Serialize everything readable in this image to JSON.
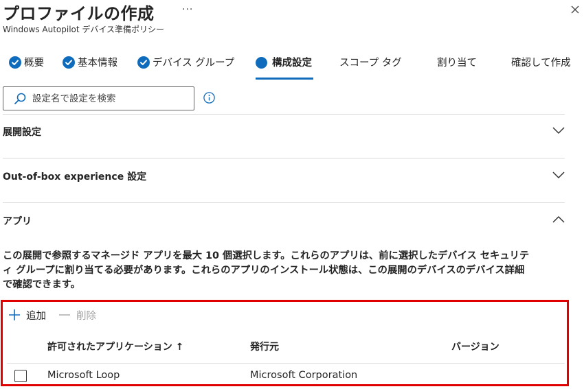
{
  "header": {
    "title": "プロファイルの作成",
    "more_label": "···",
    "subtitle": "Windows Autopilot デバイス準備ポリシー"
  },
  "tabs": [
    {
      "label": "概要",
      "state": "completed"
    },
    {
      "label": "基本情報",
      "state": "completed"
    },
    {
      "label": "デバイス グループ",
      "state": "completed"
    },
    {
      "label": "構成設定",
      "state": "active"
    },
    {
      "label": "スコープ タグ",
      "state": "pending"
    },
    {
      "label": "割り当て",
      "state": "pending"
    },
    {
      "label": "確認して作成",
      "state": "pending"
    }
  ],
  "search": {
    "placeholder": "設定名で設定を検索",
    "value": ""
  },
  "sections": [
    {
      "label": "展開設定",
      "expanded": false
    },
    {
      "label": "Out-of-box experience 設定",
      "expanded": false
    },
    {
      "label": "アプリ",
      "expanded": true
    }
  ],
  "apps": {
    "description_lines": [
      "この展開で参照するマネージド アプリを最大 10 個選択します。これらのアプリは、前に選択したデバイス セキュリテ",
      "ィ グループに割り当てる必要があります。これらのアプリのインストール状態は、この展開のデバイスのデバイス詳細",
      "で確認できます。"
    ],
    "toolbar": {
      "add_label": "追加",
      "delete_label": "削除"
    },
    "columns": [
      "許可されたアプリケーション ↑",
      "発行元",
      "バージョン"
    ],
    "rows": [
      {
        "name": "Microsoft Loop",
        "publisher": "Microsoft Corporation",
        "version": "",
        "checked": false
      }
    ]
  },
  "colors": {
    "accent": "#0f6cbd",
    "highlight_border": "#e00000",
    "disabled_text": "#a0a0a0"
  },
  "icons": [
    "check-circle-icon",
    "search-icon",
    "info-icon",
    "chevron-down-icon",
    "chevron-up-icon",
    "close-icon",
    "plus-icon",
    "minus-icon"
  ]
}
